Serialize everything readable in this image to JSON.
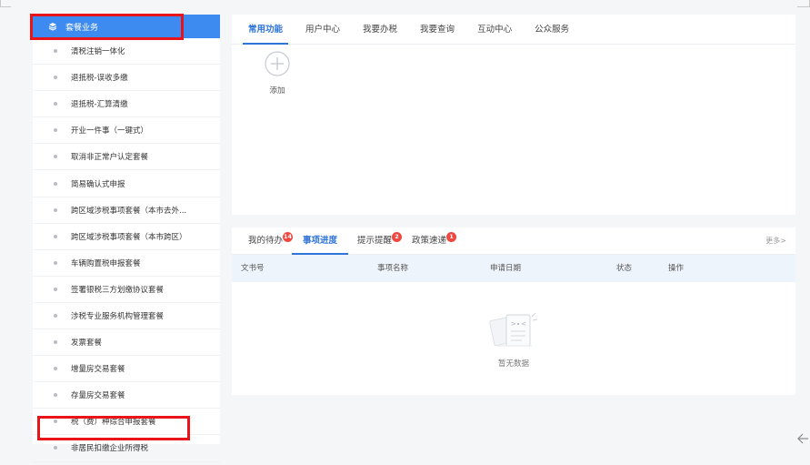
{
  "sidebar": {
    "header": {
      "label": "套餐业务",
      "icon": "layers-icon",
      "color": "#3d8bf0"
    },
    "items": [
      {
        "label": "清税注销一体化"
      },
      {
        "label": "退抵税-误收多缴"
      },
      {
        "label": "退抵税-汇算清缴"
      },
      {
        "label": "开业一件事（一键式）"
      },
      {
        "label": "取消非正常户认定套餐"
      },
      {
        "label": "简易确认式申报"
      },
      {
        "label": "跨区域涉税事项套餐（本市去外..."
      },
      {
        "label": "跨区域涉税事项套餐（本市跨区）"
      },
      {
        "label": "车辆购置税申报套餐"
      },
      {
        "label": "签署银税三方划缴协议套餐"
      },
      {
        "label": "涉税专业服务机构管理套餐"
      },
      {
        "label": "发票套餐"
      },
      {
        "label": "增量房交易套餐"
      },
      {
        "label": "存量房交易套餐"
      },
      {
        "label": "税（费）种综合申报套餐"
      },
      {
        "label": "非居民扣缴企业所得税"
      }
    ]
  },
  "top_panel": {
    "tabs": [
      {
        "label": "常用功能",
        "active": true
      },
      {
        "label": "用户中心"
      },
      {
        "label": "我要办税"
      },
      {
        "label": "我要查询"
      },
      {
        "label": "互动中心"
      },
      {
        "label": "公众服务"
      }
    ],
    "add": {
      "label": "添加",
      "icon": "plus-circle-icon"
    }
  },
  "bottom_panel": {
    "tabs": [
      {
        "label": "我的待办",
        "badge": "14"
      },
      {
        "label": "事项进度",
        "active": true
      },
      {
        "label": "提示提醒",
        "badge": "2"
      },
      {
        "label": "政策速递",
        "badge": "1"
      }
    ],
    "more": "更多>",
    "columns": [
      "文书号",
      "事项名称",
      "申请日期",
      "状态",
      "操作"
    ],
    "empty": {
      "label": "暂无数据",
      "icon": "empty-document-icon"
    }
  },
  "colors": {
    "accent": "#2e74d9",
    "badge": "#f0483e",
    "highlight_box": "#e8141a"
  },
  "side_icon": "arrow-left-icon"
}
